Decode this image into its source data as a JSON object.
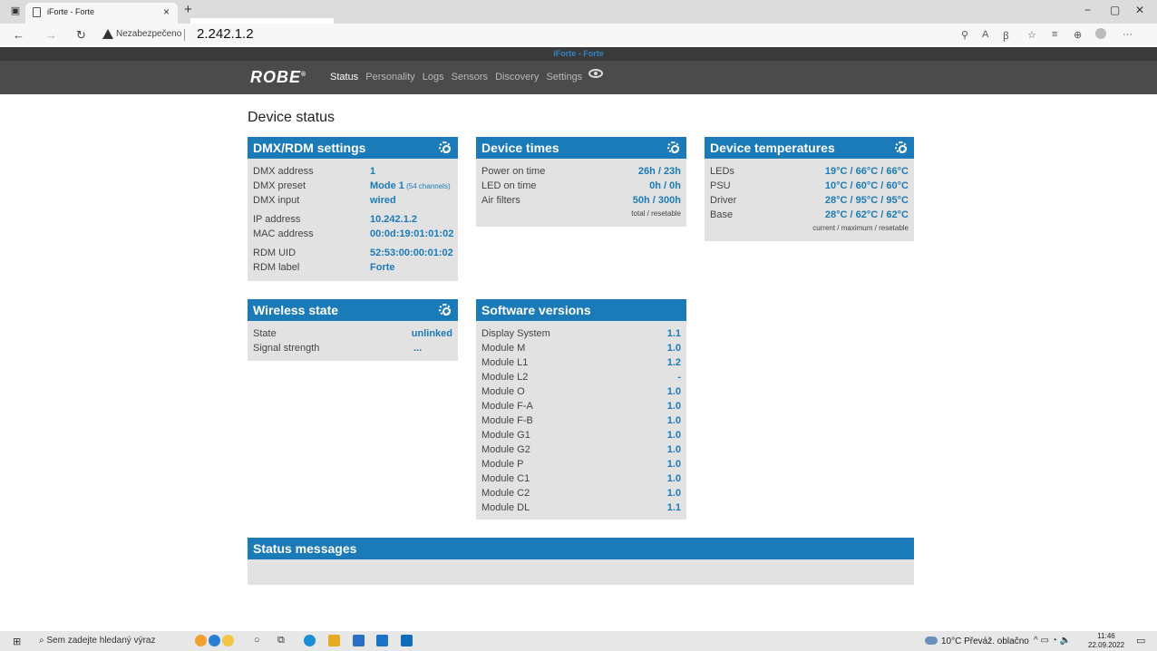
{
  "browser": {
    "tab_title": "iForte - Forte",
    "tab_close": "×",
    "new_tab": "+",
    "security_label": "Nezabezpečeno",
    "url": "2.242.1.2",
    "win_min": "−",
    "win_max": "▢",
    "win_close": "✕"
  },
  "site": {
    "top_title": "iForte - Forte",
    "logo": "ROBE",
    "logo_mark": "®",
    "menu": [
      "Status",
      "Personality",
      "Logs",
      "Sensors",
      "Discovery",
      "Settings"
    ]
  },
  "page_title": "Device status",
  "dmx": {
    "title": "DMX/RDM settings",
    "rows": [
      {
        "label": "DMX address",
        "value": "1"
      },
      {
        "label": "DMX preset",
        "value": "Mode 1",
        "extra": " (54 channels)"
      },
      {
        "label": "DMX input",
        "value": "wired"
      },
      {
        "label": "IP address",
        "value": "10.242.1.2"
      },
      {
        "label": "MAC address",
        "value": "00:0d:19:01:01:02"
      },
      {
        "label": "RDM UID",
        "value": "52:53:00:00:01:02"
      },
      {
        "label": "RDM label",
        "value": "Forte"
      }
    ]
  },
  "times": {
    "title": "Device times",
    "rows": [
      {
        "label": "Power on time",
        "value": "26h / 23h"
      },
      {
        "label": "LED on time",
        "value": "0h / 0h"
      },
      {
        "label": "Air filters",
        "value": "50h / 300h"
      }
    ],
    "note": "total / resetable"
  },
  "temps": {
    "title": "Device temperatures",
    "rows": [
      {
        "label": "LEDs",
        "value": "19°C / 66°C / 66°C"
      },
      {
        "label": "PSU",
        "value": "10°C / 60°C / 60°C"
      },
      {
        "label": "Driver",
        "value": "28°C / 95°C / 95°C"
      },
      {
        "label": "Base",
        "value": "28°C / 62°C / 62°C"
      }
    ],
    "note": "current / maximum / resetable"
  },
  "wireless": {
    "title": "Wireless state",
    "rows": [
      {
        "label": "State",
        "value": "unlinked"
      },
      {
        "label": "Signal strength",
        "value": "..."
      }
    ]
  },
  "software": {
    "title": "Software versions",
    "rows": [
      {
        "label": "Display System",
        "value": "1.1"
      },
      {
        "label": "Module M",
        "value": "1.0"
      },
      {
        "label": "Module L1",
        "value": "1.2"
      },
      {
        "label": "Module L2",
        "value": "-"
      },
      {
        "label": "Module O",
        "value": "1.0"
      },
      {
        "label": "Module F-A",
        "value": "1.0"
      },
      {
        "label": "Module F-B",
        "value": "1.0"
      },
      {
        "label": "Module G1",
        "value": "1.0"
      },
      {
        "label": "Module G2",
        "value": "1.0"
      },
      {
        "label": "Module P",
        "value": "1.0"
      },
      {
        "label": "Module C1",
        "value": "1.0"
      },
      {
        "label": "Module C2",
        "value": "1.0"
      },
      {
        "label": "Module DL",
        "value": "1.1"
      }
    ]
  },
  "messages": {
    "title": "Status messages"
  },
  "taskbar": {
    "search_placeholder": "Sem zadejte hledaný výraz",
    "weather": "10°C  Převáž. oblačno",
    "time": "11:46",
    "date": "22.09.2022"
  }
}
